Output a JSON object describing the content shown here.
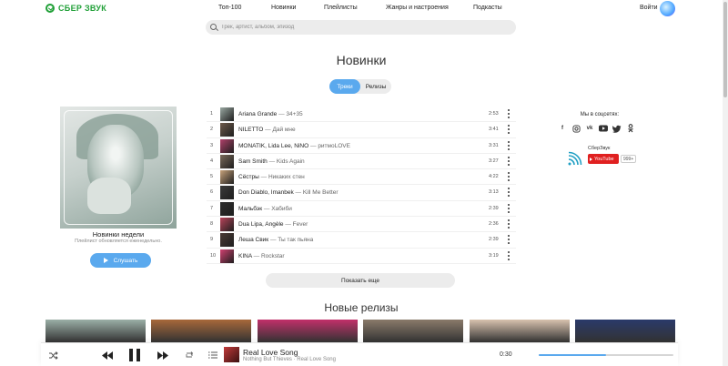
{
  "header": {
    "logo": "СБЕР ЗВУК",
    "nav": [
      "Топ-100",
      "Новинки",
      "Плейлисты",
      "Жанры и настроения",
      "Подкасты"
    ],
    "login": "Войти"
  },
  "search": {
    "placeholder": "Трек, артист, альбом, эпизод"
  },
  "page_title": "Новинки",
  "tabs": [
    {
      "label": "Треки",
      "active": true
    },
    {
      "label": "Релизы",
      "active": false
    }
  ],
  "playlist": {
    "title": "Новинки недели",
    "subtitle": "Плейлист обновляется еженедельно.",
    "listen_label": "Слушать"
  },
  "tracks": [
    {
      "num": "1",
      "artist": "Ariana Grande",
      "title": "34+35",
      "duration": "2:53",
      "color": "#9aa8a2"
    },
    {
      "num": "2",
      "artist": "NILETTO",
      "title": "Дай мне",
      "duration": "3:41",
      "color": "#6e5a4a"
    },
    {
      "num": "3",
      "artist": "MONATIK, Lida Lee, NiNO",
      "title": "ритмоLOVE",
      "duration": "3:31",
      "color": "#b0406a"
    },
    {
      "num": "4",
      "artist": "Sam Smith",
      "title": "Kids Again",
      "duration": "3:27",
      "color": "#7a6a5a"
    },
    {
      "num": "5",
      "artist": "Сёстры",
      "title": "Никаких стен",
      "duration": "4:22",
      "color": "#c7a27a"
    },
    {
      "num": "6",
      "artist": "Don Diablo, Imanbek",
      "title": "Kill Me Better",
      "duration": "3:13",
      "color": "#3a3a3a"
    },
    {
      "num": "7",
      "artist": "Мальбэк",
      "title": "Хабиби",
      "duration": "2:39",
      "color": "#2d2d2d"
    },
    {
      "num": "8",
      "artist": "Dua Lipa, Angèle",
      "title": "Fever",
      "duration": "2:36",
      "color": "#b7435a"
    },
    {
      "num": "9",
      "artist": "Леша Свик",
      "title": "Ты так пьяна",
      "duration": "2:39",
      "color": "#4b3a35"
    },
    {
      "num": "10",
      "artist": "KINA",
      "title": "Rockstar",
      "duration": "3:19",
      "color": "#d04070"
    }
  ],
  "show_more": "Показать еще",
  "social": {
    "title": "Мы в соцсетях:",
    "icons": [
      "facebook-icon",
      "instagram-icon",
      "vk-icon",
      "youtube-icon",
      "twitter-icon",
      "odnoklassniki-icon"
    ],
    "channel_name": "СберЗвук",
    "youtube_label": "YouTube",
    "subscribers": "999+"
  },
  "releases_title": "Новые релизы",
  "releases": [
    {
      "color": "#9bb0a7"
    },
    {
      "color": "#a8683a"
    },
    {
      "color": "#c2306a"
    },
    {
      "color": "#8a7a6a"
    },
    {
      "color": "#d8c2ae"
    },
    {
      "color": "#2a3a6a"
    }
  ],
  "player": {
    "title": "Real Love Song",
    "artist": "Nothing But Thieves · Real Love Song",
    "time": "0:30",
    "volume": 0.5,
    "cover_color": "#c23a3a"
  },
  "colors": {
    "accent": "#5aa9ee",
    "brand": "#21a038"
  }
}
